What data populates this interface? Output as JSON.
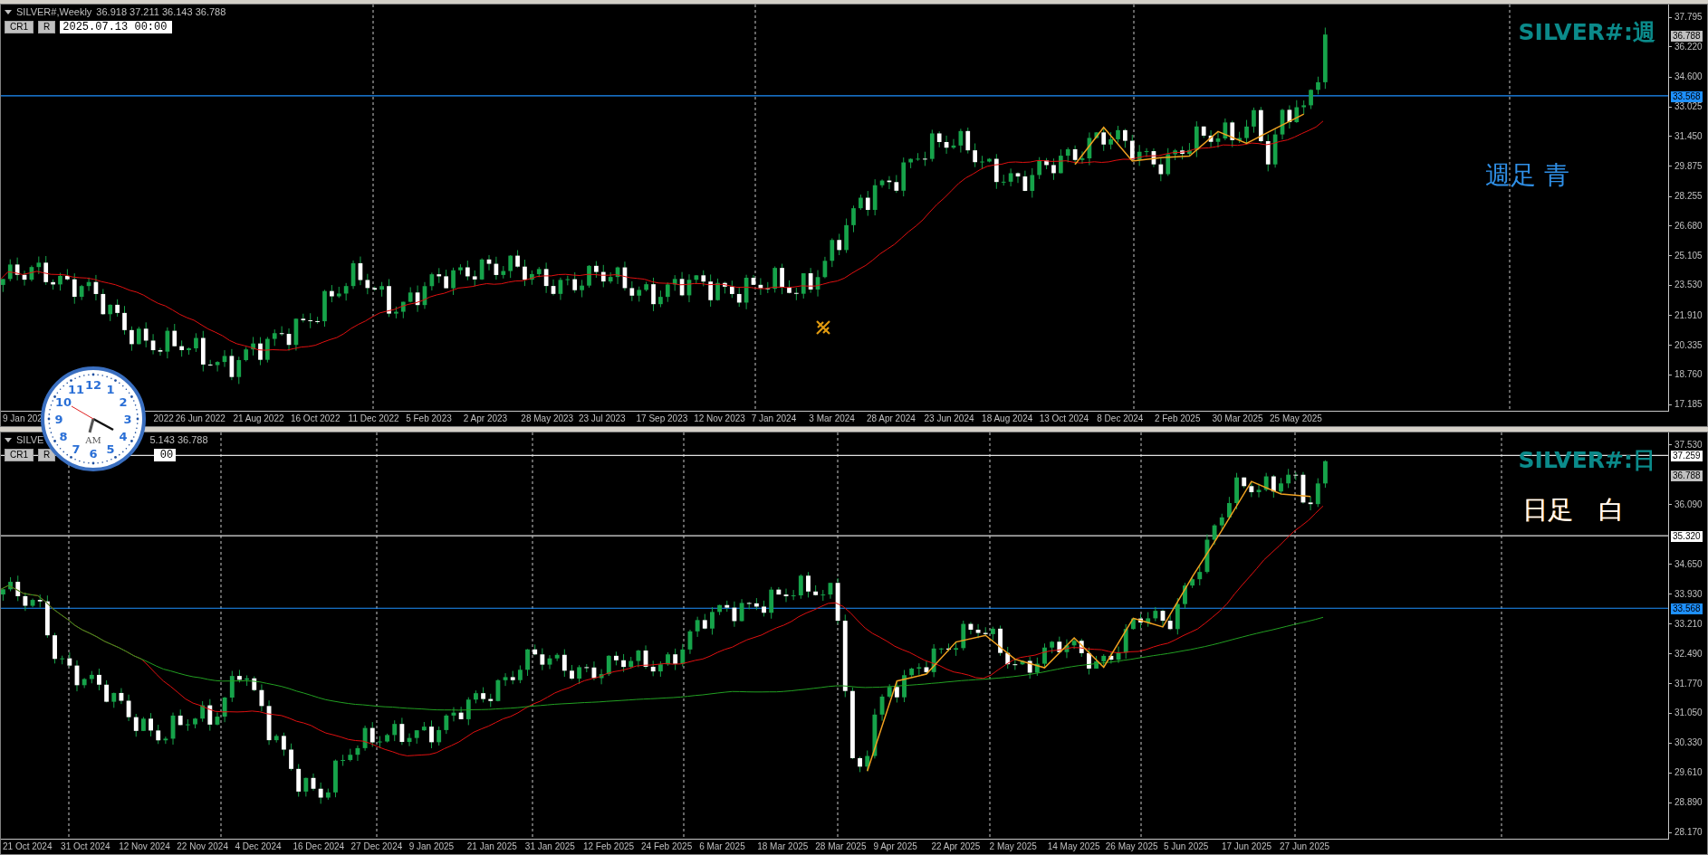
{
  "charts": [
    {
      "kind": "weekly",
      "header": {
        "symbol": "SILVER#,Weekly",
        "ohlc": "36.918 37.211 36.143 36.788",
        "buttons": [
          "CR1",
          "R"
        ],
        "date": "2025.07.13 00:00"
      },
      "title": "SILVER#:週",
      "note": {
        "text": "週足 青",
        "color": "#2f8fe6"
      },
      "price_ticks": [
        "37.795",
        "36.220",
        "34.600",
        "33.025",
        "31.450",
        "29.875",
        "28.255",
        "26.680",
        "25.105",
        "23.530",
        "21.910",
        "20.335",
        "18.760",
        "17.185"
      ],
      "price_labels": [
        {
          "text": "36.788",
          "kind": "current"
        },
        {
          "text": "33.568",
          "kind": "blue-line"
        }
      ],
      "dates": [
        "9 Jan 202",
        "2022",
        "26 Jun 2022",
        "21 Aug 2022",
        "16 Oct 2022",
        "11 Dec 2022",
        "5 Feb 2023",
        "2 Apr 2023",
        "28 May 2023",
        "23 Jul 2023",
        "17 Sep 2023",
        "12 Nov 2023",
        "7 Jan 2024",
        "3 Mar 2024",
        "28 Apr 2024",
        "23 Jun 2024",
        "18 Aug 2024",
        "13 Oct 2024",
        "8 Dec 2024",
        "2 Feb 2025",
        "30 Mar 2025",
        "25 May 2025"
      ]
    },
    {
      "kind": "daily",
      "header": {
        "symbol": "SILVE",
        "ohlc": "5.143 36.788",
        "buttons": [
          "CR1",
          "R"
        ],
        "date": "00"
      },
      "title": "SILVER#:日",
      "note": {
        "text": "日足　白",
        "color": "#ffffff"
      },
      "price_ticks": [
        "37.530",
        "36.090",
        "34.650",
        "33.930",
        "33.210",
        "32.490",
        "31.770",
        "31.050",
        "30.330",
        "29.610",
        "28.890",
        "28.170"
      ],
      "price_labels": [
        {
          "text": "37.259",
          "kind": "white-line"
        },
        {
          "text": "36.788",
          "kind": "current"
        },
        {
          "text": "35.320",
          "kind": "white-line"
        },
        {
          "text": "33.568",
          "kind": "blue-line"
        }
      ],
      "dates": [
        "21 Oct 2024",
        "31 Oct 2024",
        "12 Nov 2024",
        "22 Nov 2024",
        "4 Dec 2024",
        "16 Dec 2024",
        "27 Dec 2024",
        "9 Jan 2025",
        "21 Jan 2025",
        "31 Jan 2025",
        "12 Feb 2025",
        "24 Feb 2025",
        "6 Mar 2025",
        "18 Mar 2025",
        "28 Mar 2025",
        "9 Apr 2025",
        "22 Apr 2025",
        "2 May 2025",
        "14 May 2025",
        "26 May 2025",
        "5 Jun 2025",
        "17 Jun 2025",
        "27 Jun 2025"
      ]
    }
  ],
  "clock": {
    "numerals": [
      "12",
      "11",
      "1",
      "10",
      "2",
      "9",
      "3",
      "8",
      "4",
      "7",
      "5",
      "6"
    ],
    "period": "AM"
  }
}
